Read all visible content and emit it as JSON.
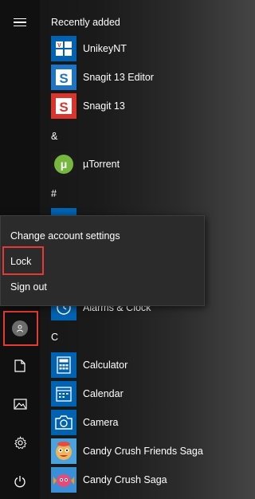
{
  "rail": {
    "icons": [
      "hamburger-icon",
      "user-icon",
      "document-icon",
      "pictures-icon",
      "settings-icon",
      "power-icon"
    ]
  },
  "sections": {
    "recent": "Recently added",
    "amp": "&",
    "hash": "#",
    "c": "C"
  },
  "apps": {
    "unikey": "UnikeyNT",
    "snagit_editor": "Snagit 13 Editor",
    "snagit": "Snagit 13",
    "utorrent": "µTorrent",
    "alarms": "Alarms & Clock",
    "calculator": "Calculator",
    "calendar": "Calendar",
    "camera": "Camera",
    "candy_friends": "Candy Crush Friends Saga",
    "candy": "Candy Crush Saga"
  },
  "account_menu": {
    "change": "Change account settings",
    "lock": "Lock",
    "signout": "Sign out"
  },
  "colors": {
    "accent_red": "#e53935",
    "tile_blue": "#0063b1",
    "snagit_blue": "#1e74c4",
    "snagit_red": "#d9352c",
    "utorrent_green": "#76b83f"
  }
}
